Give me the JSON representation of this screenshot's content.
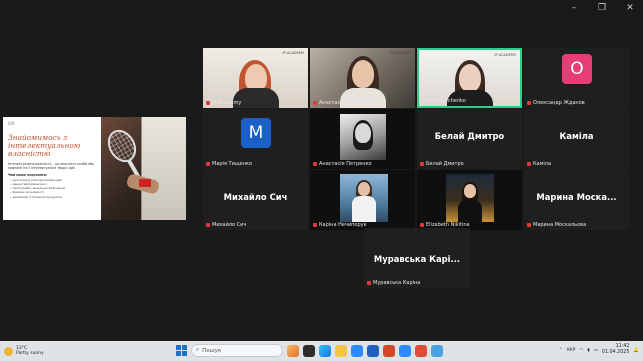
{
  "window": {
    "controls": [
      "–",
      "❐",
      "✕"
    ]
  },
  "slide": {
    "number": "0/8",
    "title": "Знайомимось з інтелектуальною власністю",
    "paragraph": "Інтелектуальна власність – це власність особи або компанії на її інтелектуальні творчі ідеї.",
    "list_heading": "Чим може охороняти:",
    "bullets": [
      "• оригінальні (альтернативні ідеї)",
      "• децентралізовані речі",
      "• пропорційні, визначені власником",
      "• формою можливості",
      "• дизайнові (сторінкові продукти)"
    ]
  },
  "participants": [
    {
      "name": "IP Academy",
      "type": "video",
      "muted": true
    },
    {
      "name": "Анастасія Бирківська",
      "type": "video",
      "muted": true
    },
    {
      "name": "Yuliia Kravchenko",
      "type": "video",
      "muted": false,
      "active": true
    },
    {
      "name": "Олександр Жданов",
      "type": "avatar",
      "initial": "O",
      "color": "#e33c73",
      "muted": true
    },
    {
      "name": "Марія Тищенко",
      "type": "avatar",
      "initial": "M",
      "color": "#1b60c8",
      "muted": true
    },
    {
      "name": "Анастасія Петренко",
      "type": "photo",
      "muted": true
    },
    {
      "name": "Белай Дмитро",
      "type": "text",
      "display": "Белай Дмитро",
      "muted": true
    },
    {
      "name": "Каміла",
      "type": "text",
      "display": "Каміла",
      "muted": true
    },
    {
      "name": "Михайло Сич",
      "type": "text",
      "display": "Михайло Сич",
      "muted": true
    },
    {
      "name": "Каріна Нечипорук",
      "type": "photo",
      "muted": true
    },
    {
      "name": "Elizabeth Nikitina",
      "type": "photo",
      "muted": true
    },
    {
      "name": "Марина Москальова",
      "type": "text",
      "display": "Марина Моска...",
      "muted": true
    }
  ],
  "bottom_participant": {
    "name": "Муравська Каріна",
    "display": "Муравська Карі...",
    "muted": true
  },
  "video_watermark": "IP ACADEMY",
  "taskbar": {
    "temperature": "13°C",
    "weather": "Partly sunny",
    "search_placeholder": "Пошук",
    "lang": "УКР",
    "time": "11:42",
    "date": "01.04.2025"
  }
}
